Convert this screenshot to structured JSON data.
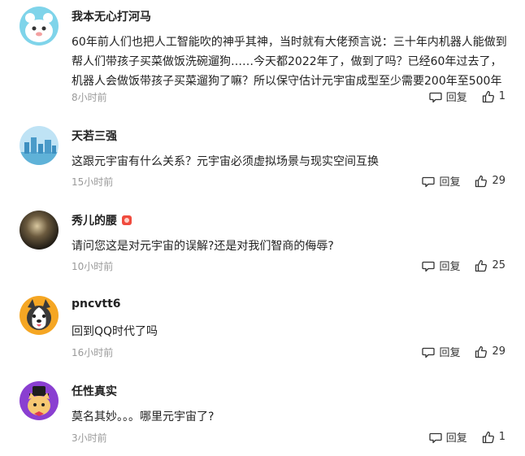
{
  "comments": [
    {
      "username": "我本无心打河马",
      "text": "60年前人们也把人工智能吹的神乎其神，当时就有大佬预言说：三十年内机器人能做到帮人们带孩子买菜做饭洗碗遛狗……今天都2022年了，做到了吗？已经60年过去了，机器人会做饭带孩子买菜遛狗了嘛？所以保守估计元宇宙成型至少需要200年至500年",
      "time": "8小时前",
      "reply_label": "回复",
      "likes": "1"
    },
    {
      "username": "天若三强",
      "text": "这跟元宇宙有什么关系？元宇宙必须虚拟场景与现实空间互换",
      "time": "15小时前",
      "reply_label": "回复",
      "likes": "29"
    },
    {
      "username": "秀儿的腰",
      "text": "请问您这是对元宇宙的误解?还是对我们智商的侮辱?",
      "time": "10小时前",
      "reply_label": "回复",
      "likes": "25"
    },
    {
      "username": "pncvtt6",
      "text": "回到QQ时代了吗",
      "time": "16小时前",
      "reply_label": "回复",
      "likes": "29"
    },
    {
      "username": "任性真实",
      "text": "莫名其妙。。。哪里元宇宙了?",
      "time": "3小时前",
      "reply_label": "回复",
      "likes": "1"
    }
  ],
  "icons": {
    "reply": "speech-bubble-icon",
    "like": "thumbs-up-icon",
    "badge": "user-badge-icon"
  },
  "colors": {
    "text": "#222222",
    "meta": "#9a9a9a",
    "badge": "#f04b3e"
  }
}
